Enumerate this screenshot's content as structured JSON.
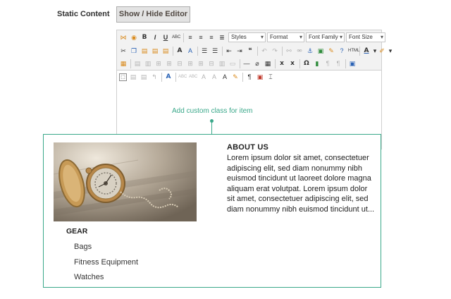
{
  "field": {
    "label": "Static Content"
  },
  "toggle_button": {
    "label": "Show / Hide Editor"
  },
  "toolbar": {
    "styles_select": "Styles",
    "format_select": "Format",
    "font_family_select": "Font Family",
    "font_size_select": "Font Size"
  },
  "hint": {
    "text": "Add custom class for item"
  },
  "about": {
    "title": "ABOUT US",
    "text": "Lorem ipsum dolor sit amet, consectetuer adipiscing elit, sed diam nonummy nibh euismod tincidunt ut laoreet dolore magna aliquam erat volutpat. Lorem ipsum dolor sit amet, consectetuer adipiscing elit, sed diam nonummy nibh euismod tincidunt ut..."
  },
  "gear": {
    "title": "GEAR",
    "links": [
      "Bags",
      "Fitness Equipment",
      "Watches"
    ]
  },
  "colors": {
    "accent": "#3aa88a",
    "button_bg": "#e3e3e3",
    "border": "#cfcfcf"
  }
}
